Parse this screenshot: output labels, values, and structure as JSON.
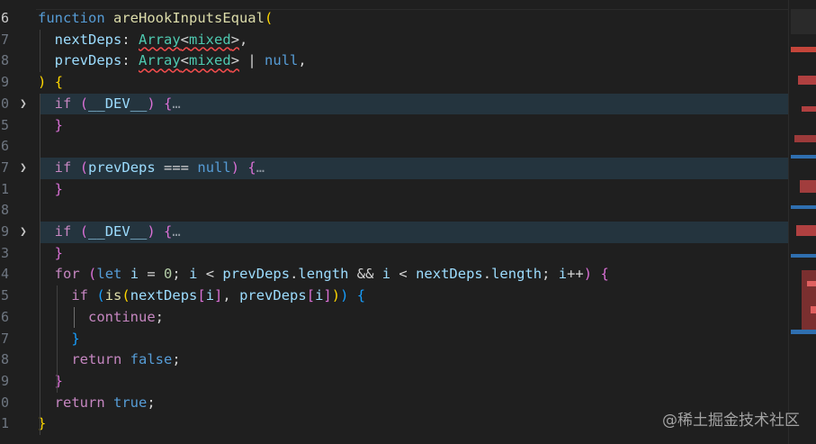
{
  "editor": {
    "language": "javascript",
    "line_numbers": [
      "6",
      "7",
      "8",
      "9",
      "0",
      "5",
      "6",
      "7",
      "1",
      "8",
      "9",
      "3",
      "4",
      "5",
      "6",
      "7",
      "8",
      "9",
      "0",
      "1"
    ],
    "lines": [
      {
        "ln": "6",
        "active": true,
        "tokens": [
          [
            "kw",
            "function"
          ],
          [
            "op",
            " "
          ],
          [
            "fn",
            "areHookInputsEqual"
          ],
          [
            "p1",
            "("
          ]
        ]
      },
      {
        "ln": "7",
        "tokens": [
          [
            "op",
            "  "
          ],
          [
            "var",
            "nextDeps"
          ],
          [
            "op",
            ": "
          ],
          [
            "type squig",
            "Array"
          ],
          [
            "op squig",
            "<"
          ],
          [
            "type squig",
            "mixed"
          ],
          [
            "op squig",
            ">"
          ],
          [
            "op",
            ","
          ]
        ]
      },
      {
        "ln": "8",
        "tokens": [
          [
            "op",
            "  "
          ],
          [
            "var",
            "prevDeps"
          ],
          [
            "op",
            ": "
          ],
          [
            "type squig",
            "Array"
          ],
          [
            "op squig",
            "<"
          ],
          [
            "type squig",
            "mixed"
          ],
          [
            "op squig",
            ">"
          ],
          [
            "op",
            " | "
          ],
          [
            "kw",
            "null"
          ],
          [
            "op",
            ","
          ]
        ]
      },
      {
        "ln": "9",
        "tokens": [
          [
            "p1",
            ")"
          ],
          [
            "op",
            " "
          ],
          [
            "p1",
            "{"
          ]
        ]
      },
      {
        "ln": "0",
        "folded": true,
        "tokens": [
          [
            "op",
            "  "
          ],
          [
            "ctl",
            "if"
          ],
          [
            "op",
            " "
          ],
          [
            "p2",
            "("
          ],
          [
            "var",
            "__DEV__"
          ],
          [
            "p2",
            ")"
          ],
          [
            "op",
            " "
          ],
          [
            "p2",
            "{"
          ],
          [
            "ellipsis",
            "…"
          ]
        ]
      },
      {
        "ln": "5",
        "tokens": [
          [
            "op",
            "  "
          ],
          [
            "p2",
            "}"
          ]
        ]
      },
      {
        "ln": "6",
        "tokens": []
      },
      {
        "ln": "7",
        "folded": true,
        "tokens": [
          [
            "op",
            "  "
          ],
          [
            "ctl",
            "if"
          ],
          [
            "op",
            " "
          ],
          [
            "p2",
            "("
          ],
          [
            "var",
            "prevDeps"
          ],
          [
            "op",
            " === "
          ],
          [
            "kw",
            "null"
          ],
          [
            "p2",
            ")"
          ],
          [
            "op",
            " "
          ],
          [
            "p2",
            "{"
          ],
          [
            "ellipsis",
            "…"
          ]
        ]
      },
      {
        "ln": "1",
        "tokens": [
          [
            "op",
            "  "
          ],
          [
            "p2",
            "}"
          ]
        ]
      },
      {
        "ln": "8",
        "tokens": []
      },
      {
        "ln": "9",
        "folded": true,
        "tokens": [
          [
            "op",
            "  "
          ],
          [
            "ctl",
            "if"
          ],
          [
            "op",
            " "
          ],
          [
            "p2",
            "("
          ],
          [
            "var",
            "__DEV__"
          ],
          [
            "p2",
            ")"
          ],
          [
            "op",
            " "
          ],
          [
            "p2",
            "{"
          ],
          [
            "ellipsis",
            "…"
          ]
        ]
      },
      {
        "ln": "3",
        "tokens": [
          [
            "op",
            "  "
          ],
          [
            "p2",
            "}"
          ]
        ]
      },
      {
        "ln": "4",
        "tokens": [
          [
            "op",
            "  "
          ],
          [
            "ctl",
            "for"
          ],
          [
            "op",
            " "
          ],
          [
            "p2",
            "("
          ],
          [
            "kw",
            "let"
          ],
          [
            "op",
            " "
          ],
          [
            "var",
            "i"
          ],
          [
            "op",
            " = "
          ],
          [
            "num",
            "0"
          ],
          [
            "op",
            "; "
          ],
          [
            "var",
            "i"
          ],
          [
            "op",
            " < "
          ],
          [
            "var",
            "prevDeps"
          ],
          [
            "op",
            "."
          ],
          [
            "var",
            "length"
          ],
          [
            "op",
            " && "
          ],
          [
            "var",
            "i"
          ],
          [
            "op",
            " < "
          ],
          [
            "var",
            "nextDeps"
          ],
          [
            "op",
            "."
          ],
          [
            "var",
            "length"
          ],
          [
            "op",
            "; "
          ],
          [
            "var",
            "i"
          ],
          [
            "op",
            "++"
          ],
          [
            "p2",
            ")"
          ],
          [
            "op",
            " "
          ],
          [
            "p2",
            "{"
          ]
        ]
      },
      {
        "ln": "5",
        "tokens": [
          [
            "op",
            "    "
          ],
          [
            "ctl",
            "if"
          ],
          [
            "op",
            " "
          ],
          [
            "p3",
            "("
          ],
          [
            "fn",
            "is"
          ],
          [
            "p1",
            "("
          ],
          [
            "var",
            "nextDeps"
          ],
          [
            "p2",
            "["
          ],
          [
            "var",
            "i"
          ],
          [
            "p2",
            "]"
          ],
          [
            "op",
            ", "
          ],
          [
            "var",
            "prevDeps"
          ],
          [
            "p2",
            "["
          ],
          [
            "var",
            "i"
          ],
          [
            "p2",
            "]"
          ],
          [
            "p1",
            ")"
          ],
          [
            "p3",
            ")"
          ],
          [
            "op",
            " "
          ],
          [
            "p3",
            "{"
          ]
        ]
      },
      {
        "ln": "6",
        "tokens": [
          [
            "op",
            "      "
          ],
          [
            "ctl",
            "continue"
          ],
          [
            "op",
            ";"
          ]
        ]
      },
      {
        "ln": "7",
        "tokens": [
          [
            "op",
            "    "
          ],
          [
            "p3",
            "}"
          ]
        ]
      },
      {
        "ln": "8",
        "tokens": [
          [
            "op",
            "    "
          ],
          [
            "ctl",
            "return"
          ],
          [
            "op",
            " "
          ],
          [
            "kw",
            "false"
          ],
          [
            "op",
            ";"
          ]
        ]
      },
      {
        "ln": "9",
        "tokens": [
          [
            "op",
            "  "
          ],
          [
            "p2",
            "}"
          ]
        ]
      },
      {
        "ln": "0",
        "tokens": [
          [
            "op",
            "  "
          ],
          [
            "ctl",
            "return"
          ],
          [
            "op",
            " "
          ],
          [
            "kw",
            "true"
          ],
          [
            "op",
            ";"
          ]
        ]
      },
      {
        "ln": "1",
        "tokens": [
          [
            "p1",
            "}"
          ]
        ]
      }
    ]
  },
  "icons": {
    "fold": "chevron-right-icon"
  },
  "colors": {
    "background": "#1f1f1f",
    "folded_line": "#24343e",
    "error_squiggle": "#f14c4c"
  },
  "watermark": "@稀土掘金技术社区"
}
